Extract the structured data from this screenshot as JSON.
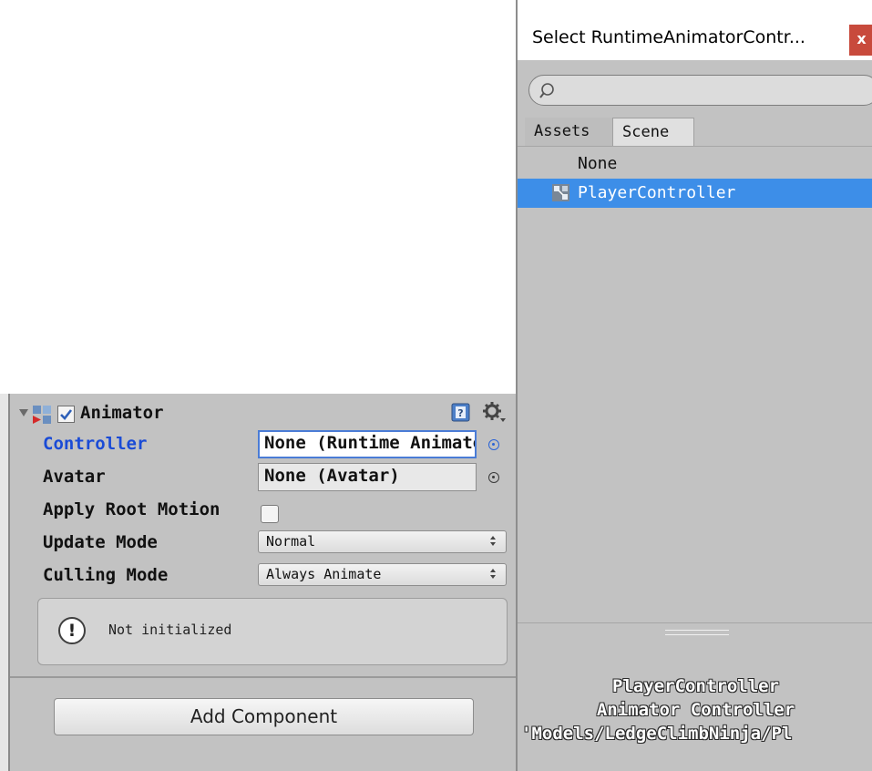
{
  "inspector": {
    "component": {
      "title": "Animator",
      "enabled": true,
      "help_icon": "help-book-icon",
      "settings_icon": "gear-icon"
    },
    "properties": {
      "controller": {
        "label": "Controller",
        "value": "None (Runtime Animator Controller)"
      },
      "avatar": {
        "label": "Avatar",
        "value": "None (Avatar)"
      },
      "apply_root_motion": {
        "label": "Apply Root Motion",
        "checked": false
      },
      "update_mode": {
        "label": "Update Mode",
        "value": "Normal"
      },
      "culling_mode": {
        "label": "Culling Mode",
        "value": "Always Animate"
      }
    },
    "helpbox": {
      "text": "Not initialized",
      "icon": "info-icon"
    },
    "add_component_label": "Add Component"
  },
  "select_window": {
    "title": "Select RuntimeAnimatorContr...",
    "close_label": "x",
    "search": {
      "placeholder": "",
      "value": ""
    },
    "tabs": [
      {
        "label": "Assets",
        "active": true
      },
      {
        "label": "Scene",
        "active": false
      }
    ],
    "items": [
      {
        "label": "None",
        "selected": false
      },
      {
        "label": "PlayerController",
        "selected": true,
        "icon": "animator-controller-icon"
      }
    ],
    "preview": {
      "name": "PlayerController",
      "type": "Animator Controller",
      "path": "'Models/LedgeClimbNinja/Pl"
    }
  },
  "colors": {
    "selection": "#3d8ee8",
    "active_label": "#1a4bd6",
    "close_button": "#c84a3c",
    "panel_bg": "#c2c2c2"
  }
}
